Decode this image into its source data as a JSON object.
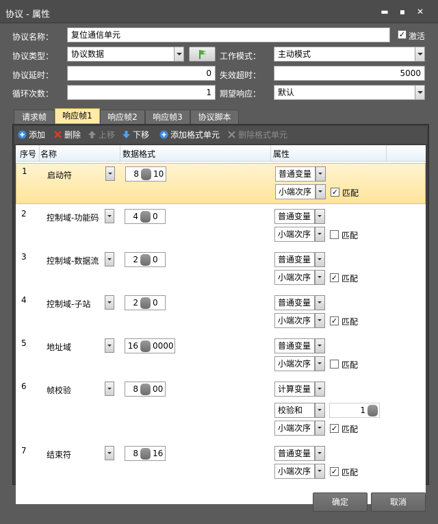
{
  "window": {
    "title": "协议 - 属性"
  },
  "form": {
    "name_label": "协议名称：",
    "name_value": "复位通信单元",
    "activate_label": "激活",
    "activate_checked": true,
    "type_label": "协议类型：",
    "type_value": "协议数据",
    "mode_label": "工作模式：",
    "mode_value": "主动模式",
    "delay_label": "协议延时：",
    "delay_value": "0",
    "timeout_label": "失效超时：",
    "timeout_value": "5000",
    "loop_label": "循环次数：",
    "loop_value": "1",
    "expect_label": "期望响应：",
    "expect_value": "默认"
  },
  "tabs": [
    "请求帧",
    "响应帧1",
    "响应帧2",
    "响应帧3",
    "协议脚本"
  ],
  "active_tab": 1,
  "toolbar": {
    "add": "添加",
    "delete": "删除",
    "up": "上移",
    "down": "下移",
    "add_fmt": "添加格式单元",
    "del_fmt": "删除格式单元"
  },
  "columns": {
    "seq": "序号",
    "name": "名称",
    "format": "数据格式",
    "prop": "属性"
  },
  "rows": [
    {
      "seq": "1",
      "name": "启动符",
      "fmt_a": "8",
      "fmt_b": "10",
      "p1": "普通变量",
      "p2": "小端次序",
      "match": "匹配",
      "checked": "✓"
    },
    {
      "seq": "2",
      "name": "控制域-功能码",
      "fmt_a": "4",
      "fmt_b": "0",
      "p1": "普通变量",
      "p2": "小端次序",
      "match": "匹配",
      "checked": ""
    },
    {
      "seq": "3",
      "name": "控制域-数据流",
      "fmt_a": "2",
      "fmt_b": "0",
      "p1": "普通变量",
      "p2": "小端次序",
      "match": "匹配",
      "checked": "✓"
    },
    {
      "seq": "4",
      "name": "控制域-子站",
      "fmt_a": "2",
      "fmt_b": "0",
      "p1": "普通变量",
      "p2": "小端次序",
      "match": "匹配",
      "checked": "✓"
    },
    {
      "seq": "5",
      "name": "地址域",
      "fmt_a": "16",
      "fmt_b": "0000",
      "p1": "普通变量",
      "p2": "小端次序",
      "match": "匹配",
      "checked": ""
    },
    {
      "seq": "6",
      "name": "帧校验",
      "fmt_a": "8",
      "fmt_b": "00",
      "p1": "计算变量",
      "p_mid": "校验和",
      "p_mid_num": "1",
      "p2": "小端次序",
      "match": "匹配",
      "checked": "✓"
    },
    {
      "seq": "7",
      "name": "结束符",
      "fmt_a": "8",
      "fmt_b": "16",
      "p1": "普通变量",
      "p2": "小端次序",
      "match": "匹配",
      "checked": "✓"
    }
  ],
  "buttons": {
    "ok": "确定",
    "cancel": "取消"
  }
}
